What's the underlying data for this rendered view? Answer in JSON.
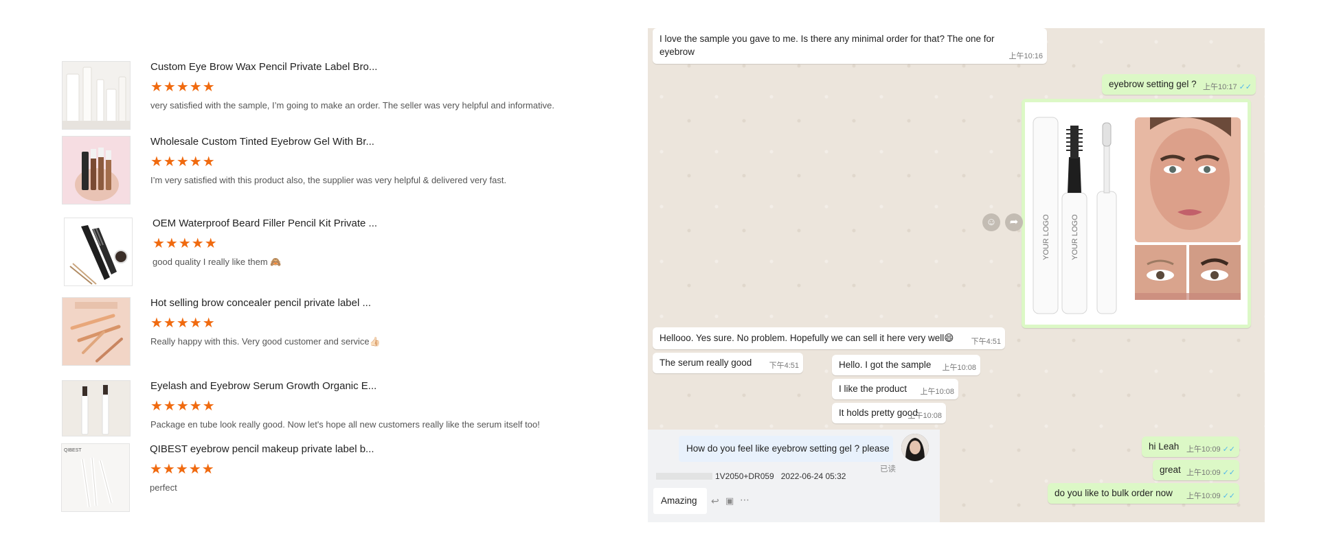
{
  "reviews": [
    {
      "title": "Custom Eye Brow Wax Pencil Private Label Bro...",
      "stars": "★★★★★",
      "text": "very satisfied with the sample, I’m going to make an order. The seller was very helpful and informative."
    },
    {
      "title": "Wholesale Custom Tinted Eyebrow Gel With Br...",
      "stars": "★★★★★",
      "text": "I’m very satisfied with this product also, the supplier was very helpful & delivered very fast."
    },
    {
      "title": "OEM Waterproof Beard Filler Pencil Kit Private ...",
      "stars": "★★★★★",
      "text": "good quality I really like  them 🙈"
    },
    {
      "title": "Hot selling brow concealer pencil private label ...",
      "stars": "★★★★★",
      "text": "Really happy with this. Very good customer and service👍🏻"
    },
    {
      "title": "Eyelash and Eyebrow Serum Growth Organic E...",
      "stars": "★★★★★",
      "text": "Package en tube look really good. Now let's hope all new customers really like the serum itself too!"
    },
    {
      "title": "QIBEST eyebrow pencil makeup private label b...",
      "stars": "★★★★★",
      "text": "perfect",
      "brand": "QIBEST"
    }
  ],
  "chat": {
    "messages": [
      {
        "line1": "I love the sample you gave to me. Is there any minimal order for that? The one for",
        "line2": "eyebrow",
        "time": "上午10:16"
      },
      {
        "text": "eyebrow setting gel ?",
        "time": "上午10:17",
        "ticks": "✓✓"
      },
      {
        "text": "Hellooo. Yes sure. No problem. Hopefully we can sell it here very well😄",
        "time": "下午4:51"
      },
      {
        "text": "The serum really good",
        "time": "下午4:51"
      },
      {
        "text": "Hello. I got the sample",
        "time": "上午10:08"
      },
      {
        "text": "I like the product",
        "time": "上午10:08"
      },
      {
        "text": "It holds pretty good",
        "time": "上午10:08"
      },
      {
        "text": "hi Leah",
        "time": "上午10:09",
        "ticks": "✓✓"
      },
      {
        "text": "great",
        "time": "上午10:09",
        "ticks": "✓✓"
      },
      {
        "text": "do you like to bulk order now",
        "time": "上午10:09",
        "ticks": "✓✓"
      }
    ],
    "image_labels": {
      "logo": "YOUR LOGO"
    },
    "panel2": {
      "question": "How do you feel like eyebrow setting gel ? please",
      "read_status": "已读",
      "sender_meta": "1V2050+DR059   2022-06-24 05:32",
      "reply": "Amazing"
    }
  },
  "colors": {
    "star": "#f06a0f",
    "chat_bg": "#ece5dc",
    "outgoing_bubble": "#dcf8c6",
    "tick_blue": "#4fb6ec"
  }
}
